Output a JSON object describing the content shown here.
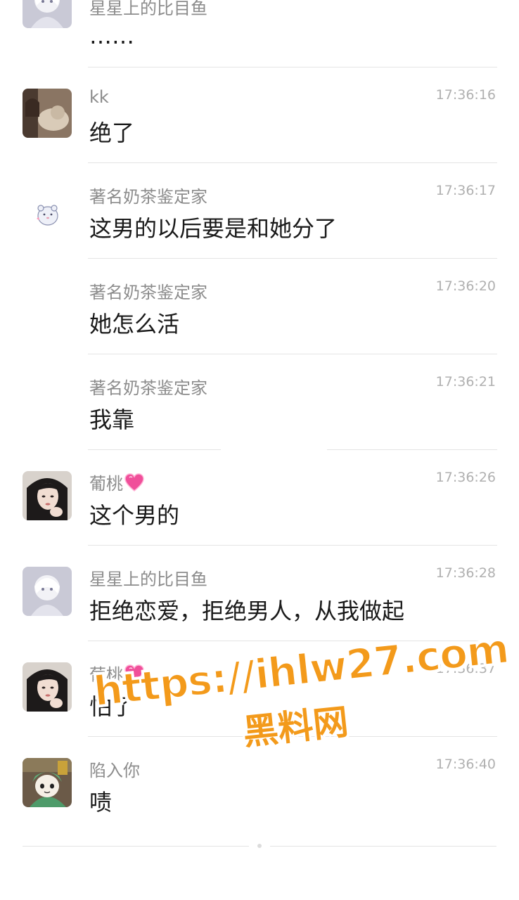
{
  "messages": [
    {
      "name": "星星上的比目鱼",
      "time": "",
      "text": "……",
      "avatar": "anime-girl-avatar"
    },
    {
      "name": "kk",
      "time": "17:36:16",
      "text": "绝了",
      "avatar": "cat-photo-avatar"
    },
    {
      "name": "著名奶茶鉴定家",
      "time": "17:36:17",
      "text": "这男的以后要是和她分了",
      "avatar": "hamster-sticker-avatar"
    },
    {
      "name": "著名奶茶鉴定家",
      "time": "17:36:20",
      "text": "她怎么活",
      "avatar": ""
    },
    {
      "name": "著名奶茶鉴定家",
      "time": "17:36:21",
      "text": "我靠",
      "avatar": ""
    },
    {
      "name": "葡桃",
      "time": "17:36:26",
      "text": "这个男的",
      "avatar": "girl-selfie-avatar"
    },
    {
      "name": "星星上的比目鱼",
      "time": "17:36:28",
      "text": "拒绝恋爱，拒绝男人，从我做起",
      "avatar": "anime-girl-avatar"
    },
    {
      "name": "葡桃",
      "time": "17:36:37",
      "text": "怕了",
      "avatar": "girl-selfie-avatar"
    },
    {
      "name": "陷入你",
      "time": "17:36:40",
      "text": "啧",
      "avatar": "cartoon-frog-hat-avatar"
    }
  ],
  "watermark": {
    "line1": "https://ihlw27.com",
    "line2": "黑料网"
  },
  "colors": {
    "name": "#8c8c8c",
    "time": "#b0b0b0",
    "text": "#1a1a1a",
    "divider": "#e4e4e4",
    "watermark": "#f39a1b"
  }
}
